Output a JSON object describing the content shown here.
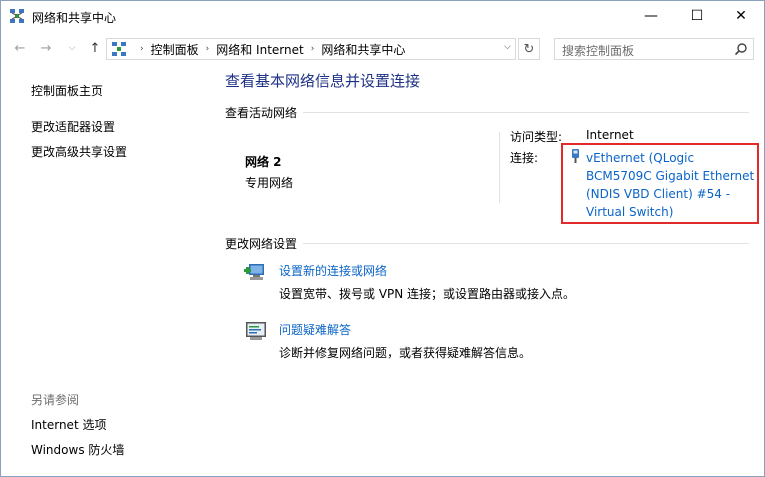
{
  "window": {
    "title": "网络和共享中心",
    "minimize": "—",
    "maximize": "☐",
    "close": "✕"
  },
  "nav": {
    "back": "←",
    "forward": "→",
    "recent": "⌵",
    "up": "↑",
    "breadcrumbs": [
      "控制面板",
      "网络和 Internet",
      "网络和共享中心"
    ],
    "refresh": "↻",
    "search_placeholder": "搜索控制面板"
  },
  "sidebar": {
    "home": "控制面板主页",
    "items": [
      "更改适配器设置",
      "更改高级共享设置"
    ],
    "see_also_label": "另请参阅",
    "see_also": [
      "Internet 选项",
      "Windows 防火墙"
    ]
  },
  "main": {
    "title": "查看基本网络信息并设置连接",
    "active_section": "查看活动网络",
    "network": {
      "name": "网络  2",
      "type": "专用网络",
      "access_label": "访问类型:",
      "access_value": "Internet",
      "connection_label": "连接:",
      "connection_lines": [
        "vEthernet (QLogic",
        "BCM5709C Gigabit Ethernet",
        "(NDIS VBD Client) #54 -",
        "Virtual Switch)"
      ]
    },
    "change_section": "更改网络设置",
    "tasks": [
      {
        "title": "设置新的连接或网络",
        "desc": "设置宽带、拨号或 VPN 连接；或设置路由器或接入点。"
      },
      {
        "title": "问题疑难解答",
        "desc": "诊断并修复网络问题，或者获得疑难解答信息。"
      }
    ]
  },
  "colors": {
    "link": "#0a64c8",
    "title": "#1e3287",
    "highlight": "#e32a2a"
  }
}
